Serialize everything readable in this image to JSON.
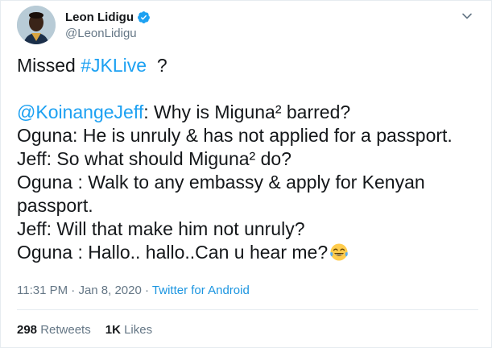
{
  "author": {
    "name": "Leon Lidigu",
    "handle": "@LeonLidigu",
    "verified": true
  },
  "tweet": {
    "intro_prefix": "Missed ",
    "intro_hashtag": "#JKLive",
    "intro_suffix": "  ?",
    "mention": "@KoinangeJeff",
    "line1_rest": ": Why is Miguna² barred?",
    "line2": "Oguna: He is unruly & has not applied for a passport.",
    "line3": "Jeff: So what should Miguna² do?",
    "line4": "Oguna : Walk to any embassy & apply for Kenyan",
    "line5": "passport.",
    "line6": "Jeff: Will that make him not unruly?",
    "line7": "Oguna : Hallo.. hallo..Can u hear me?",
    "emoji": "face-with-tears-of-joy"
  },
  "meta": {
    "time": "11:31 PM",
    "separator1": " · ",
    "date": "Jan 8, 2020",
    "separator2": " · ",
    "source": "Twitter for Android"
  },
  "stats": {
    "retweets_count": "298",
    "retweets_label": " Retweets",
    "likes_count": "1K",
    "likes_label": " Likes"
  },
  "colors": {
    "link": "#1da1f2",
    "secondary_text": "#657786",
    "primary_text": "#14171a",
    "border": "#e6ecf0"
  }
}
